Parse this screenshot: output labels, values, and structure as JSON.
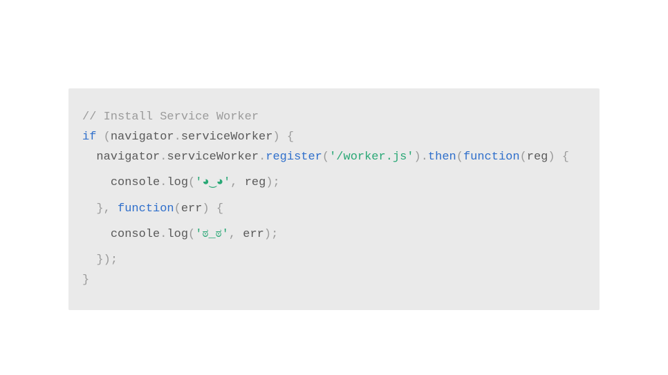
{
  "code": {
    "l1_comment": "// Install Service Worker",
    "l2_if": "if",
    "l2_sp": " ",
    "l2_paren_open": "(",
    "l2_navigator": "navigator",
    "l2_dot": ".",
    "l2_sw": "serviceWorker",
    "l2_paren_close": ")",
    "l2_brace_open": " {",
    "l3_indent": "  ",
    "l3_navigator": "navigator",
    "l3_dot1": ".",
    "l3_sw": "serviceWorker",
    "l3_dot2": ".",
    "l3_register": "register",
    "l3_paren_open": "(",
    "l3_string": "'/worker.js'",
    "l3_paren_close": ")",
    "l3_dot3": ".",
    "l3_then": "then",
    "l3_paren_open2": "(",
    "l3_function": "function",
    "l3_paren_open3": "(",
    "l3_reg": "reg",
    "l3_paren_close3": ")",
    "l3_brace_open": " {",
    "l4_indent": "    ",
    "l4_console": "console",
    "l4_dot": ".",
    "l4_log": "log",
    "l4_paren_open": "(",
    "l4_string": "'◕‿◕'",
    "l4_comma": ",",
    "l4_sp": " ",
    "l4_reg": "reg",
    "l4_paren_close": ")",
    "l4_semi": ";",
    "l5_indent": "  ",
    "l5_brace_close": "}",
    "l5_comma": ",",
    "l5_sp": " ",
    "l5_function": "function",
    "l5_paren_open": "(",
    "l5_err": "err",
    "l5_paren_close": ")",
    "l5_brace_open": " {",
    "l6_indent": "    ",
    "l6_console": "console",
    "l6_dot": ".",
    "l6_log": "log",
    "l6_paren_open": "(",
    "l6_string": "'ಠ_ಠ'",
    "l6_comma": ",",
    "l6_sp": " ",
    "l6_err": "err",
    "l6_paren_close": ")",
    "l6_semi": ";",
    "l7_indent": "  ",
    "l7_brace_close": "}",
    "l7_paren_close": ")",
    "l7_semi": ";",
    "l8_brace_close": "}"
  }
}
